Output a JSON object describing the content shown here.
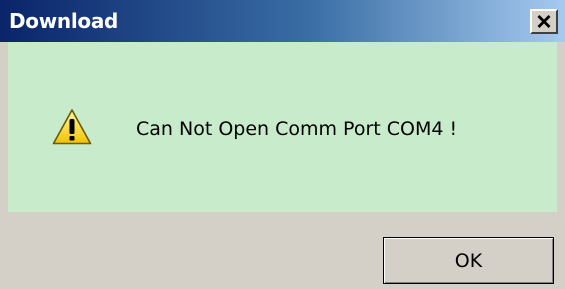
{
  "window": {
    "title": "Download",
    "close_icon": "close-icon",
    "colors": {
      "titlebar_start": "#0a246a",
      "titlebar_end": "#a6caf0",
      "content_background": "#c7ebcb",
      "dialog_background": "#d4d0c8"
    }
  },
  "message": {
    "icon": "warning-icon",
    "text": "Can Not Open Comm Port COM4 !"
  },
  "buttons": {
    "ok_label": "OK"
  }
}
